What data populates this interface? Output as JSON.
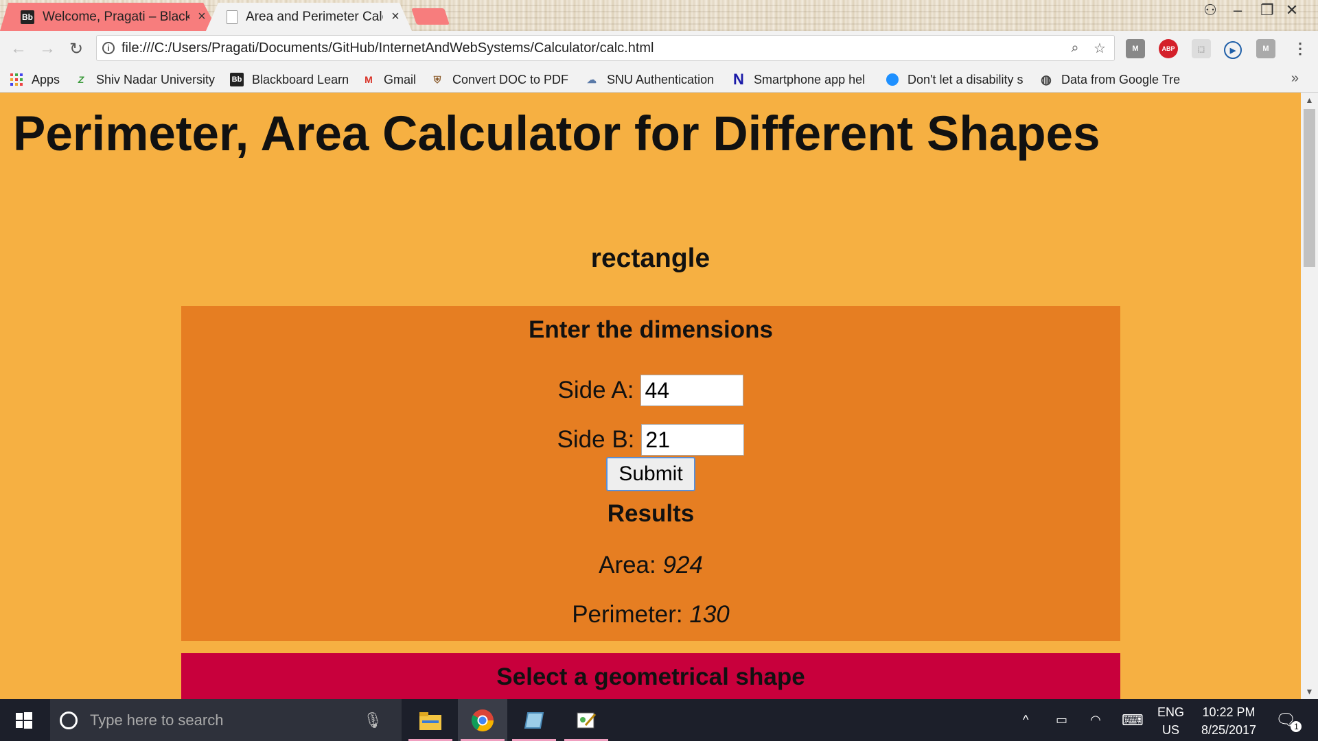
{
  "browser": {
    "tabs": [
      {
        "title": "Welcome, Pragati – Black",
        "icon": "blackboard-icon",
        "icon_text": "Bb",
        "active": false
      },
      {
        "title": "Area and Perimeter Calcu",
        "icon": "page-icon",
        "active": true
      }
    ],
    "url": "file:///C:/Users/Pragati/Documents/GitHub/InternetAndWebSystems/Calculator/calc.html",
    "extensions": [
      {
        "name": "mendeley-icon",
        "label": "M"
      },
      {
        "name": "adblock-icon",
        "label": "ABP"
      },
      {
        "name": "pdf-icon",
        "label": ""
      },
      {
        "name": "play-icon",
        "label": ""
      },
      {
        "name": "gmail-m-icon",
        "label": "M"
      }
    ],
    "bookmarks": [
      {
        "label": "Apps",
        "icon": "apps-grid-icon"
      },
      {
        "label": "Shiv Nadar University",
        "icon": "snu-icon"
      },
      {
        "label": "Blackboard Learn",
        "icon": "blackboard-icon",
        "icon_text": "Bb"
      },
      {
        "label": "Gmail",
        "icon": "gmail-icon",
        "icon_text": "M"
      },
      {
        "label": "Convert DOC to PDF",
        "icon": "convert-icon"
      },
      {
        "label": "SNU Authentication",
        "icon": "cloud-icon"
      },
      {
        "label": "Smartphone app hel",
        "icon": "n-logo-icon",
        "icon_text": "N"
      },
      {
        "label": "Don't let a disability s",
        "icon": "blue-dot-icon"
      },
      {
        "label": "Data from Google Tre",
        "icon": "globe-icon"
      }
    ],
    "bookmarks_more": "»"
  },
  "page": {
    "title": "Perimeter, Area Calculator for Different Shapes",
    "shape": "rectangle",
    "form": {
      "heading": "Enter the dimensions",
      "side_a_label": "Side A:",
      "side_a_value": "44",
      "side_b_label": "Side B:",
      "side_b_value": "21",
      "submit_label": "Submit"
    },
    "results": {
      "heading": "Results",
      "area_label": "Area:",
      "area_value": "924",
      "perimeter_label": "Perimeter:",
      "perimeter_value": "130"
    },
    "select_heading": "Select a geometrical shape"
  },
  "taskbar": {
    "search_placeholder": "Type here to search",
    "language_top": "ENG",
    "language_bottom": "US",
    "time": "10:22 PM",
    "date": "8/25/2017",
    "notification_count": "1"
  },
  "colors": {
    "page_background": "#f6b042",
    "calc_box": "#e67e22",
    "select_box": "#c8003c",
    "tab_inactive": "#f77d7d"
  }
}
